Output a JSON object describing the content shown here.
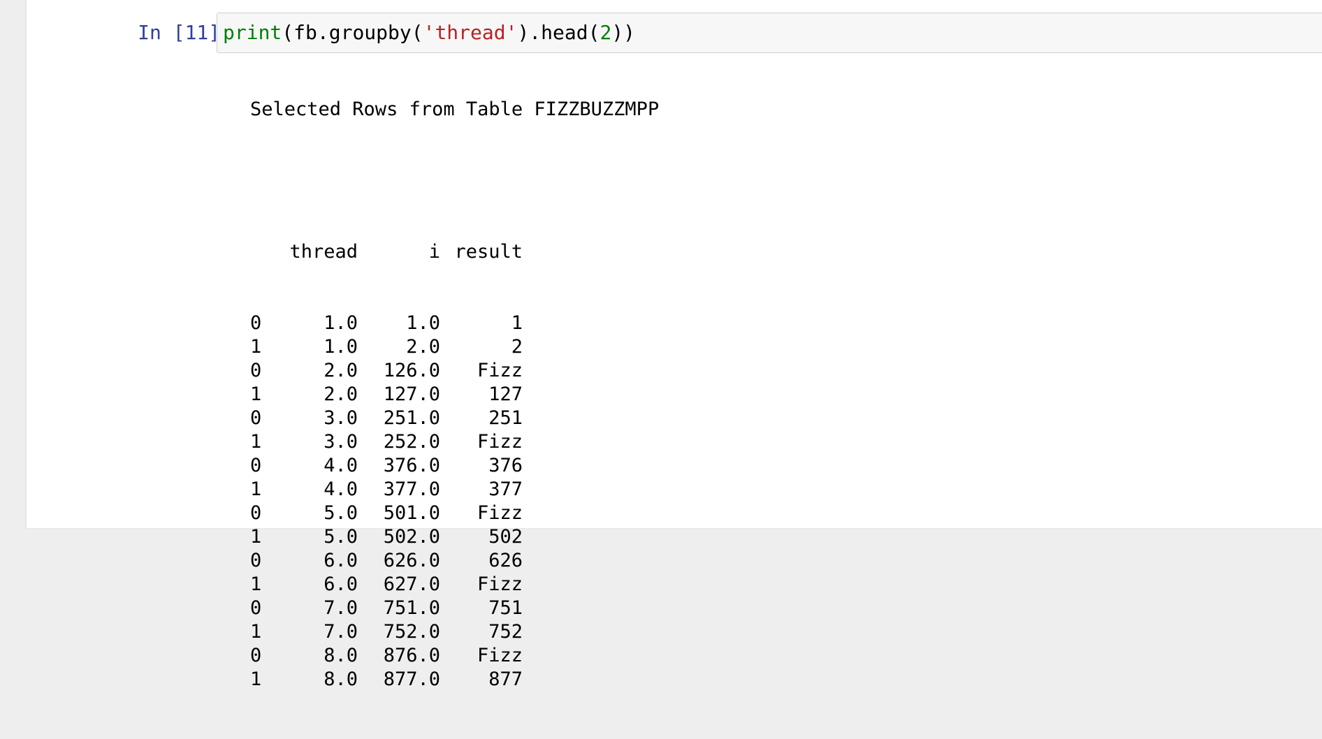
{
  "cell": {
    "prompt": "In [11]:",
    "code": {
      "print_fn": "print",
      "open_paren": "(",
      "object_call": "fb.groupby(",
      "string_arg": "'thread'",
      "head_call": ").head(",
      "number_arg": "2",
      "close": "))"
    }
  },
  "output": {
    "title": "Selected Rows from Table FIZZBUZZMPP",
    "columns": [
      "",
      "thread",
      "i",
      "result"
    ],
    "rows": [
      [
        "0",
        "1.0",
        "1.0",
        "1"
      ],
      [
        "1",
        "1.0",
        "2.0",
        "2"
      ],
      [
        "0",
        "2.0",
        "126.0",
        "Fizz"
      ],
      [
        "1",
        "2.0",
        "127.0",
        "127"
      ],
      [
        "0",
        "3.0",
        "251.0",
        "251"
      ],
      [
        "1",
        "3.0",
        "252.0",
        "Fizz"
      ],
      [
        "0",
        "4.0",
        "376.0",
        "376"
      ],
      [
        "1",
        "4.0",
        "377.0",
        "377"
      ],
      [
        "0",
        "5.0",
        "501.0",
        "Fizz"
      ],
      [
        "1",
        "5.0",
        "502.0",
        "502"
      ],
      [
        "0",
        "6.0",
        "626.0",
        "626"
      ],
      [
        "1",
        "6.0",
        "627.0",
        "Fizz"
      ],
      [
        "0",
        "7.0",
        "751.0",
        "751"
      ],
      [
        "1",
        "7.0",
        "752.0",
        "752"
      ],
      [
        "0",
        "8.0",
        "876.0",
        "Fizz"
      ],
      [
        "1",
        "8.0",
        "877.0",
        "877"
      ]
    ]
  },
  "colors": {
    "prompt": "#303f9f",
    "builtin": "#008000",
    "string": "#ba2121",
    "number": "#008000",
    "input_background": "#f7f7f7"
  }
}
